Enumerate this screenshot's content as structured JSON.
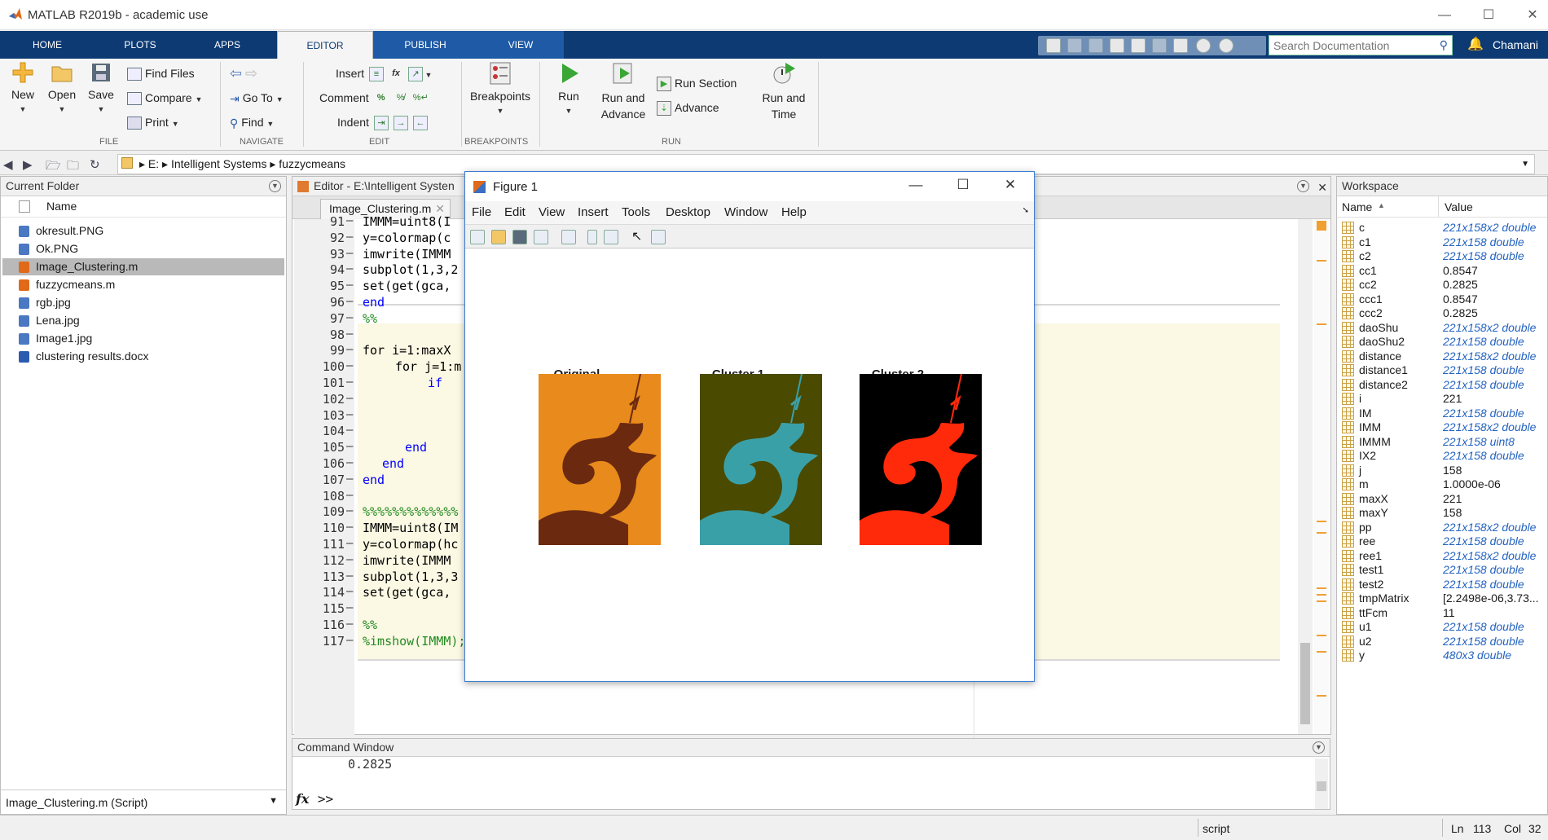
{
  "app": {
    "title": "MATLAB R2019b - academic use",
    "user": "Chamani"
  },
  "ribbon_tabs": [
    "HOME",
    "PLOTS",
    "APPS",
    "EDITOR",
    "PUBLISH",
    "VIEW"
  ],
  "search": {
    "placeholder": "Search Documentation"
  },
  "toolstrip": {
    "file": {
      "section": "FILE",
      "new": "New",
      "open": "Open",
      "save": "Save",
      "find_files": "Find Files",
      "compare": "Compare",
      "print": "Print"
    },
    "navigate": {
      "section": "NAVIGATE",
      "go_to": "Go To",
      "find": "Find"
    },
    "edit": {
      "section": "EDIT",
      "insert": "Insert",
      "comment": "Comment",
      "indent": "Indent"
    },
    "breakpoints": {
      "section": "BREAKPOINTS",
      "label": "Breakpoints"
    },
    "run": {
      "section": "RUN",
      "run": "Run",
      "run_and_advance": [
        "Run and",
        "Advance"
      ],
      "run_section": "Run Section",
      "advance": "Advance",
      "run_and_time": [
        "Run and",
        "Time"
      ]
    }
  },
  "address": {
    "drive": "E:",
    "parts": [
      "Intelligent Systems",
      "fuzzycmeans"
    ]
  },
  "current_folder": {
    "title": "Current Folder",
    "column": "Name",
    "files": [
      {
        "name": "okresult.PNG",
        "type": "png"
      },
      {
        "name": "Ok.PNG",
        "type": "png"
      },
      {
        "name": "Image_Clustering.m",
        "type": "m",
        "selected": true
      },
      {
        "name": "fuzzycmeans.m",
        "type": "m"
      },
      {
        "name": "rgb.jpg",
        "type": "jpg"
      },
      {
        "name": "Lena.jpg",
        "type": "jpg"
      },
      {
        "name": "Image1.jpg",
        "type": "jpg"
      },
      {
        "name": "clustering results.docx",
        "type": "docx"
      }
    ],
    "details": "Image_Clustering.m  (Script)"
  },
  "editor": {
    "title": "Editor - E:\\Intelligent Systen",
    "tab": "Image_Clustering.m",
    "lines": [
      {
        "n": "91",
        "t": "IMMM=uint8(I"
      },
      {
        "n": "92",
        "t": "y=colormap(c"
      },
      {
        "n": "93",
        "t": "imwrite(IMMM"
      },
      {
        "n": "94",
        "t": "subplot(1,3,2"
      },
      {
        "n": "95",
        "t": "set(get(gca,"
      },
      {
        "n": "96",
        "t": "end",
        "kw": true
      },
      {
        "n": "97",
        "t": "%%",
        "cm": true
      },
      {
        "n": "98",
        "t": ""
      },
      {
        "n": "99",
        "t": "for i=1:maxX",
        "kw_prefix": "for"
      },
      {
        "n": "100",
        "t": "for j=1:m",
        "kw_prefix": "for",
        "indent": 1
      },
      {
        "n": "101",
        "t": "if",
        "kw": true,
        "indent": 2
      },
      {
        "n": "102",
        "t": ""
      },
      {
        "n": "103",
        "t": ""
      },
      {
        "n": "104",
        "t": ""
      },
      {
        "n": "105",
        "t": "end",
        "kw": true,
        "indent": 1.3
      },
      {
        "n": "106",
        "t": "end",
        "kw": true,
        "indent": 0.6
      },
      {
        "n": "107",
        "t": "end",
        "kw": true
      },
      {
        "n": "108",
        "t": ""
      },
      {
        "n": "109",
        "t": "%%%%%%%%%%%%%",
        "cm": true
      },
      {
        "n": "110",
        "t": "IMMM=uint8(IM"
      },
      {
        "n": "111",
        "t": "y=colormap(hc"
      },
      {
        "n": "112",
        "t": "imwrite(IMMM"
      },
      {
        "n": "113",
        "t": "subplot(1,3,3"
      },
      {
        "n": "114",
        "t": "set(get(gca,"
      },
      {
        "n": "115",
        "t": ""
      },
      {
        "n": "116",
        "t": "%%",
        "cm": true
      },
      {
        "n": "117",
        "t": "%imshow(IMMM);",
        "cm": true
      }
    ]
  },
  "figure": {
    "title": "Figure 1",
    "menu": [
      "File",
      "Edit",
      "View",
      "Insert",
      "Tools",
      "Desktop",
      "Window",
      "Help"
    ],
    "subplots": [
      {
        "title": "Original",
        "bg": "#e88a1c",
        "fg": "#6b2a10"
      },
      {
        "title": "Cluster 1",
        "bg": "#4a4a00",
        "fg": "#3aa0a8"
      },
      {
        "title": "Cluster 2",
        "bg": "#000000",
        "fg": "#ff2a0a"
      }
    ]
  },
  "workspace": {
    "title": "Workspace",
    "col_name": "Name",
    "col_value": "Value",
    "vars": [
      {
        "name": "c",
        "value": "221x158x2 double",
        "dim": true
      },
      {
        "name": "c1",
        "value": "221x158 double",
        "dim": true
      },
      {
        "name": "c2",
        "value": "221x158 double",
        "dim": true
      },
      {
        "name": "cc1",
        "value": "0.8547"
      },
      {
        "name": "cc2",
        "value": "0.2825"
      },
      {
        "name": "ccc1",
        "value": "0.8547"
      },
      {
        "name": "ccc2",
        "value": "0.2825"
      },
      {
        "name": "daoShu",
        "value": "221x158x2 double",
        "dim": true
      },
      {
        "name": "daoShu2",
        "value": "221x158 double",
        "dim": true
      },
      {
        "name": "distance",
        "value": "221x158x2 double",
        "dim": true
      },
      {
        "name": "distance1",
        "value": "221x158 double",
        "dim": true
      },
      {
        "name": "distance2",
        "value": "221x158 double",
        "dim": true
      },
      {
        "name": "i",
        "value": "221"
      },
      {
        "name": "IM",
        "value": "221x158 double",
        "dim": true
      },
      {
        "name": "IMM",
        "value": "221x158x2 double",
        "dim": true
      },
      {
        "name": "IMMM",
        "value": "221x158 uint8",
        "dim": true
      },
      {
        "name": "IX2",
        "value": "221x158 double",
        "dim": true
      },
      {
        "name": "j",
        "value": "158"
      },
      {
        "name": "m",
        "value": "1.0000e-06"
      },
      {
        "name": "maxX",
        "value": "221"
      },
      {
        "name": "maxY",
        "value": "158"
      },
      {
        "name": "pp",
        "value": "221x158x2 double",
        "dim": true
      },
      {
        "name": "ree",
        "value": "221x158 double",
        "dim": true
      },
      {
        "name": "ree1",
        "value": "221x158x2 double",
        "dim": true
      },
      {
        "name": "test1",
        "value": "221x158 double",
        "dim": true
      },
      {
        "name": "test2",
        "value": "221x158 double",
        "dim": true
      },
      {
        "name": "tmpMatrix",
        "value": "[2.2498e-06,3.73..."
      },
      {
        "name": "ttFcm",
        "value": "11"
      },
      {
        "name": "u1",
        "value": "221x158 double",
        "dim": true
      },
      {
        "name": "u2",
        "value": "221x158 double",
        "dim": true
      },
      {
        "name": "y",
        "value": "480x3 double",
        "dim": true
      }
    ]
  },
  "command_window": {
    "title": "Command Window",
    "output": "0.2825",
    "prompt": ">>",
    "fx": "fx"
  },
  "status": {
    "mode": "script",
    "ln_label": "Ln",
    "ln": "113",
    "col_label": "Col",
    "col": "32"
  }
}
